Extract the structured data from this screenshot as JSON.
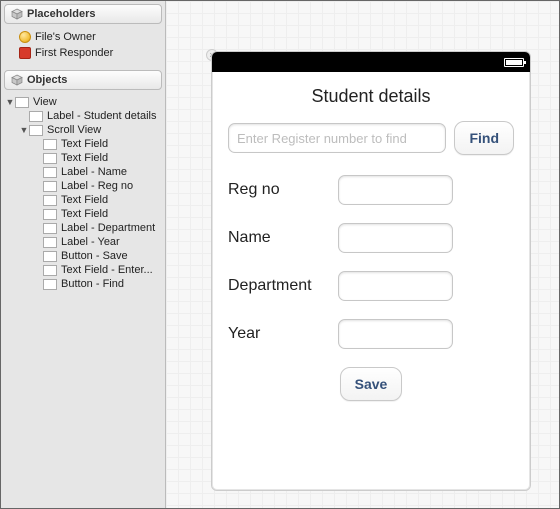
{
  "sidebar": {
    "placeholders_header": "Placeholders",
    "objects_header": "Objects",
    "placeholders": [
      {
        "label": "File's Owner"
      },
      {
        "label": "First Responder"
      }
    ],
    "tree": [
      {
        "depth": 0,
        "disclosure": "down",
        "label": "View"
      },
      {
        "depth": 1,
        "disclosure": "",
        "label": "Label - Student details"
      },
      {
        "depth": 1,
        "disclosure": "down",
        "label": "Scroll View"
      },
      {
        "depth": 2,
        "disclosure": "",
        "label": "Text Field"
      },
      {
        "depth": 2,
        "disclosure": "",
        "label": "Text Field"
      },
      {
        "depth": 2,
        "disclosure": "",
        "label": "Label - Name"
      },
      {
        "depth": 2,
        "disclosure": "",
        "label": "Label - Reg no"
      },
      {
        "depth": 2,
        "disclosure": "",
        "label": "Text Field"
      },
      {
        "depth": 2,
        "disclosure": "",
        "label": "Text Field"
      },
      {
        "depth": 2,
        "disclosure": "",
        "label": "Label - Department"
      },
      {
        "depth": 2,
        "disclosure": "",
        "label": "Label - Year"
      },
      {
        "depth": 2,
        "disclosure": "",
        "label": "Button - Save"
      },
      {
        "depth": 2,
        "disclosure": "",
        "label": "Text Field - Enter..."
      },
      {
        "depth": 2,
        "disclosure": "",
        "label": "Button - Find"
      }
    ]
  },
  "device": {
    "title": "Student details",
    "search_placeholder": "Enter Register number to find",
    "find_label": "Find",
    "fields": {
      "regno": "Reg no",
      "name": "Name",
      "department": "Department",
      "year": "Year"
    },
    "save_label": "Save"
  }
}
